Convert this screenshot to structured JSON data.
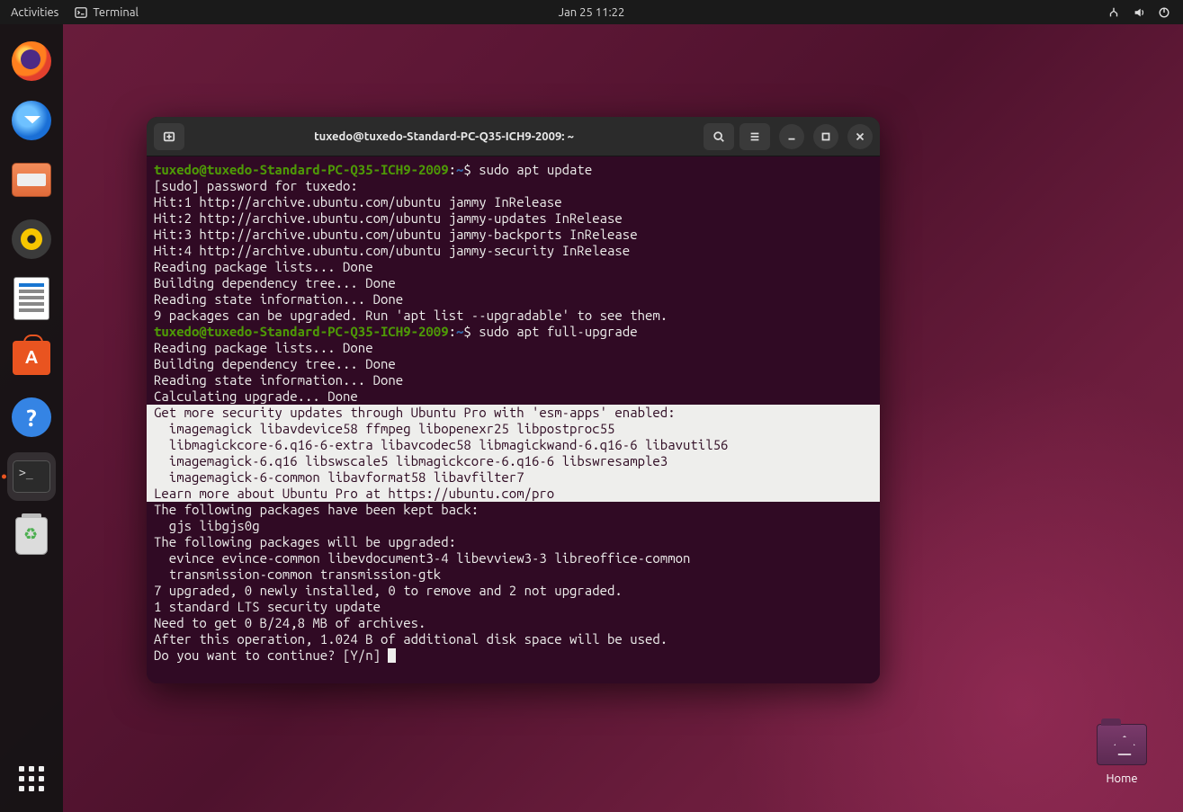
{
  "topbar": {
    "activities": "Activities",
    "app_name": "Terminal",
    "clock": "Jan 25  11:22"
  },
  "dock": {
    "apps": [
      {
        "name": "firefox"
      },
      {
        "name": "thunderbird"
      },
      {
        "name": "files"
      },
      {
        "name": "rhythmbox"
      },
      {
        "name": "libreoffice-writer"
      },
      {
        "name": "ubuntu-software"
      },
      {
        "name": "help"
      },
      {
        "name": "terminal",
        "active": true
      },
      {
        "name": "trash"
      }
    ]
  },
  "desktop": {
    "home_label": "Home"
  },
  "terminal": {
    "title": "tuxedo@tuxedo-Standard-PC-Q35-ICH9-2009: ~",
    "prompt": {
      "user_host": "tuxedo@tuxedo-Standard-PC-Q35-ICH9-2009",
      "path": "~",
      "symbol": "$"
    },
    "cmd1": "sudo apt update",
    "out1": [
      "[sudo] password for tuxedo: ",
      "Hit:1 http://archive.ubuntu.com/ubuntu jammy InRelease",
      "Hit:2 http://archive.ubuntu.com/ubuntu jammy-updates InRelease",
      "Hit:3 http://archive.ubuntu.com/ubuntu jammy-backports InRelease",
      "Hit:4 http://archive.ubuntu.com/ubuntu jammy-security InRelease",
      "Reading package lists... Done",
      "Building dependency tree... Done",
      "Reading state information... Done",
      "9 packages can be upgraded. Run 'apt list --upgradable' to see them."
    ],
    "cmd2": "sudo apt full-upgrade",
    "out2a": [
      "Reading package lists... Done",
      "Building dependency tree... Done",
      "Reading state information... Done",
      "Calculating upgrade... Done"
    ],
    "out2_hl": [
      "Get more security updates through Ubuntu Pro with 'esm-apps' enabled:",
      "  imagemagick libavdevice58 ffmpeg libopenexr25 libpostproc55",
      "  libmagickcore-6.q16-6-extra libavcodec58 libmagickwand-6.q16-6 libavutil56",
      "  imagemagick-6.q16 libswscale5 libmagickcore-6.q16-6 libswresample3",
      "  imagemagick-6-common libavformat58 libavfilter7",
      "Learn more about Ubuntu Pro at https://ubuntu.com/pro"
    ],
    "out2b": [
      "The following packages have been kept back:",
      "  gjs libgjs0g",
      "The following packages will be upgraded:",
      "  evince evince-common libevdocument3-4 libevview3-3 libreoffice-common",
      "  transmission-common transmission-gtk",
      "7 upgraded, 0 newly installed, 0 to remove and 2 not upgraded.",
      "1 standard LTS security update",
      "Need to get 0 B/24,8 MB of archives.",
      "After this operation, 1.024 B of additional disk space will be used.",
      "Do you want to continue? [Y/n] "
    ]
  }
}
